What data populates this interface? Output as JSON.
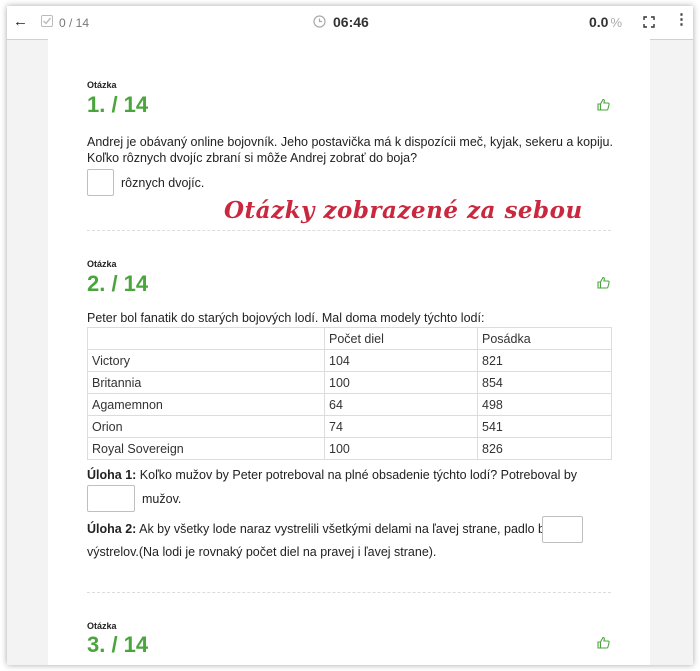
{
  "toolbar": {
    "progress": "0 / 14",
    "timer": "06:46",
    "score": "0.0",
    "score_unit": "%",
    "icons": [
      "back-arrow-icon",
      "check-icon",
      "clock-icon",
      "fullscreen-icon",
      "more-icon"
    ]
  },
  "questions": [
    {
      "label": "Otázka",
      "number": "1. / 14",
      "text_line1": "Andrej je obávaný online bojovník. Jeho postavička má k dispozícii meč, kyjak, sekeru a kopiju.",
      "text_line2": "Koľko rôznych dvojíc zbraní si môže Andrej zobrať do boja?",
      "answer_suffix": "rôznych dvojíc."
    },
    {
      "label": "Otázka",
      "number": "2. / 14",
      "intro": "Peter bol fanatik do starých bojových lodí. Mal doma modely týchto lodí:",
      "table": {
        "headers": [
          "",
          "Počet diel",
          "Posádka"
        ],
        "rows": [
          [
            "Victory",
            "104",
            "821"
          ],
          [
            "Britannia",
            "100",
            "854"
          ],
          [
            "Agamemnon",
            "64",
            "498"
          ],
          [
            "Orion",
            "74",
            "541"
          ],
          [
            "Royal Sovereign",
            "100",
            "826"
          ]
        ]
      },
      "task1_label": "Úloha 1:",
      "task1_text": "Koľko mužov by Peter potreboval na plné obsadenie týchto lodí? Potreboval by",
      "task1_suffix": "mužov.",
      "task2_label": "Úloha 2:",
      "task2_text": "Ak by všetky lode naraz vystrelili všetkými delami na ľavej strane, padlo by",
      "task2_suffix": "výstrelov.(Na lodi je rovnaký počet diel na pravej i ľavej strane)."
    },
    {
      "label": "Otázka",
      "number": "3. / 14"
    }
  ],
  "annotation": "Otázky zobrazené za sebou",
  "colors": {
    "accent_green": "#4aa63c",
    "annotation_red": "#c9283e"
  }
}
